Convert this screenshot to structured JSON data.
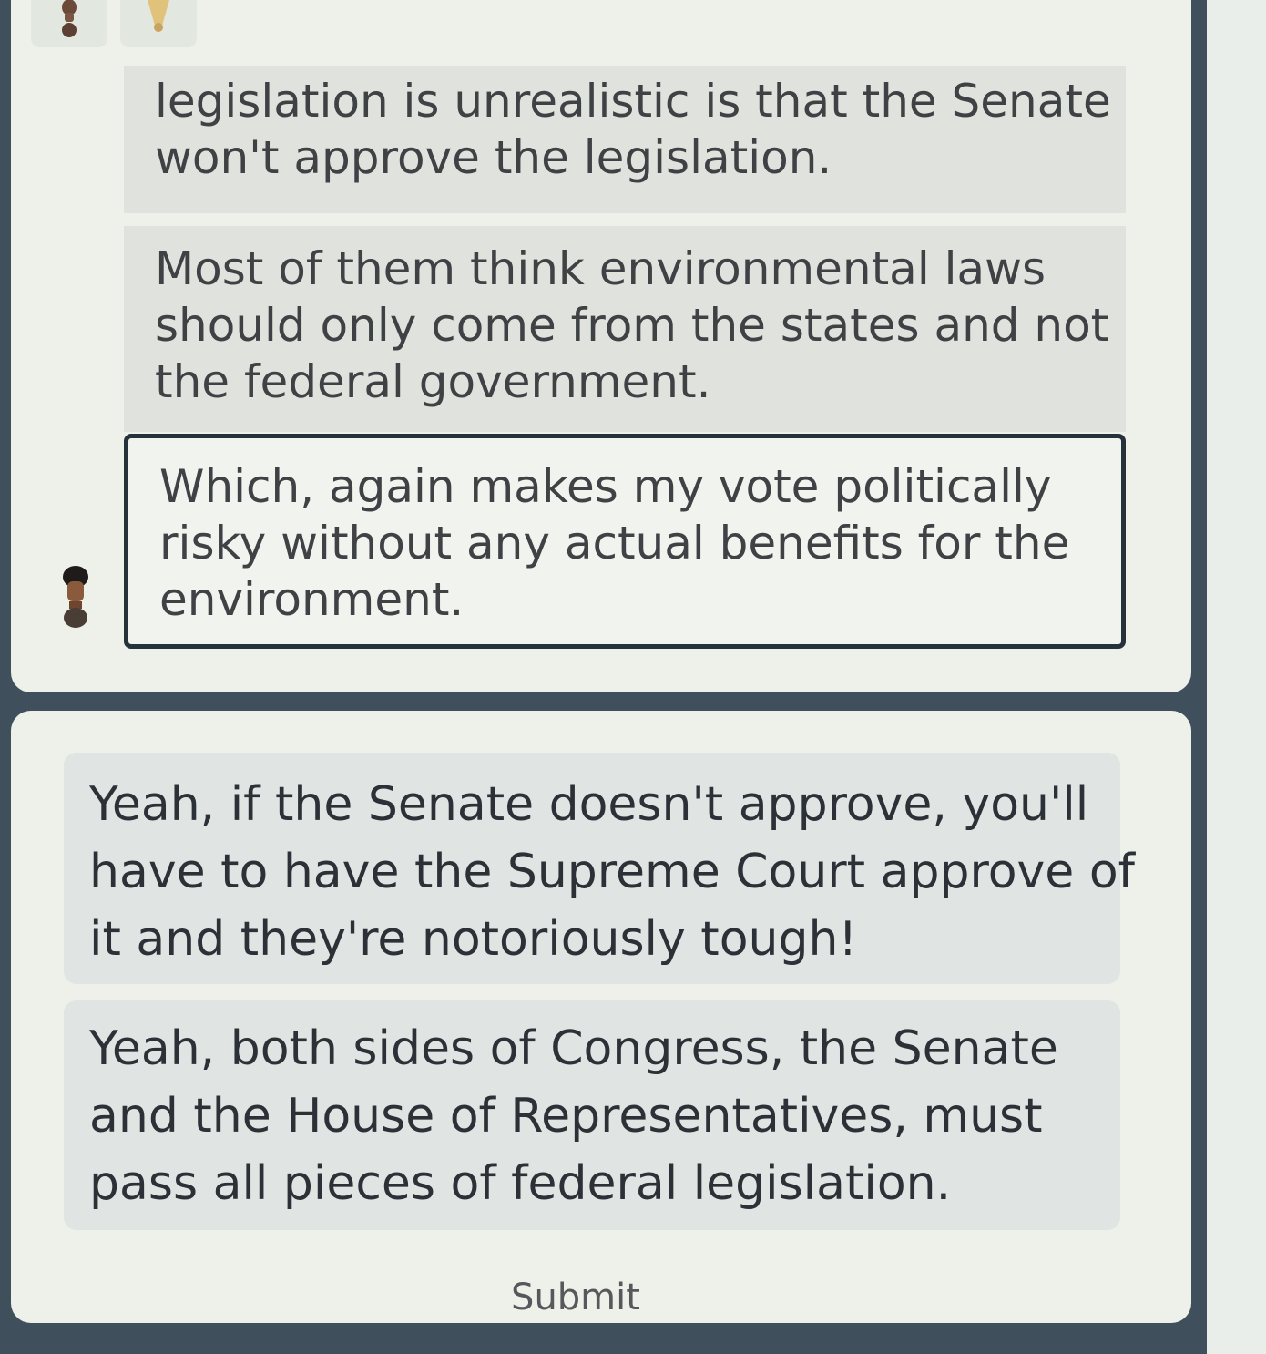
{
  "conversation": {
    "messages": [
      {
        "lines": [
          "legislation is unrealistic is that the Senate",
          "won't approve the legislation."
        ]
      },
      {
        "lines": [
          "Most of them think environmental laws",
          "should only come from the states and not",
          "the federal government."
        ]
      },
      {
        "lines": [
          "Which, again makes my vote politically",
          "risky without any actual benefits for the",
          "environment."
        ],
        "selected": true
      }
    ],
    "speaker_icon": "person-icon"
  },
  "options": [
    {
      "lines": [
        "Yeah, if the Senate doesn't approve, you'll",
        "have to have the Supreme Court approve of",
        "it and they're notoriously tough!"
      ]
    },
    {
      "lines": [
        "Yeah, both sides of Congress, the Senate",
        "and the House of Representatives, must",
        "pass all pieces of federal legislation."
      ]
    }
  ],
  "submit_label": "Submit"
}
